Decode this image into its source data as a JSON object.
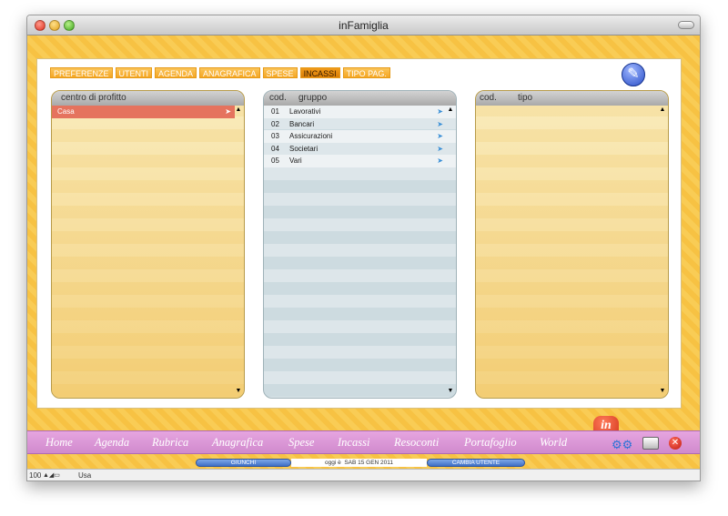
{
  "window": {
    "title": "inFamiglia"
  },
  "tabs": [
    "PREFERENZE",
    "UTENTI",
    "AGENDA",
    "ANAGRAFICA",
    "SPESE",
    "INCASSI",
    "TIPO PAG."
  ],
  "active_tab": "INCASSI",
  "col1": {
    "header": "centro di profitto",
    "rows": [
      {
        "label": "Casa"
      }
    ]
  },
  "col2": {
    "header_code": "cod.",
    "header_label": "gruppo",
    "rows": [
      {
        "code": "01",
        "label": "Lavorativi"
      },
      {
        "code": "02",
        "label": "Bancari"
      },
      {
        "code": "03",
        "label": "Assicurazioni"
      },
      {
        "code": "04",
        "label": "Societari"
      },
      {
        "code": "05",
        "label": "Vari"
      }
    ]
  },
  "col3": {
    "header_code": "cod.",
    "header_label": "tipo",
    "rows": []
  },
  "nav": [
    "Home",
    "Agenda",
    "Rubrica",
    "Anagrafica",
    "Spese",
    "Incassi",
    "Resoconti",
    "Portafoglio",
    "World"
  ],
  "logo_text": "in",
  "status": {
    "user_btn": "GIUNCHI",
    "today_prefix": "oggi è",
    "date": "SAB 15 GEN 2011",
    "change_user": "CAMBIA UTENTE"
  },
  "bottom": {
    "zoom": "100",
    "layout": "Usa"
  },
  "icons": {
    "pencil": "pencil-icon",
    "gears": "gears-icon",
    "printer": "printer-icon",
    "close": "close-icon"
  },
  "colors": {
    "accent": "#f5a623",
    "nav_bg": "#d08acd",
    "selected_row": "#e5735e"
  }
}
